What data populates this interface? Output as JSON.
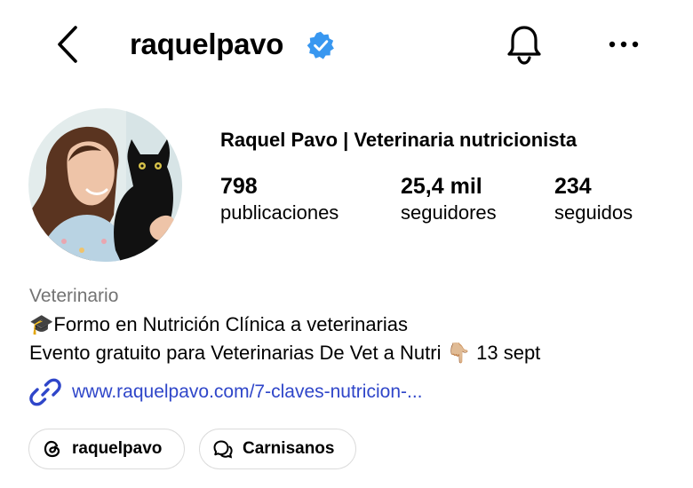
{
  "header": {
    "username": "raquelpavo",
    "icons": {
      "back": "chevron-left-icon",
      "verified": "verified-badge-icon",
      "notifications": "bell-icon",
      "more": "more-horizontal-icon"
    }
  },
  "profile": {
    "full_name": "Raquel Pavo | Veterinaria nutricionista",
    "stats": [
      {
        "value": "798",
        "label": "publicaciones"
      },
      {
        "value": "25,4 mil",
        "label": "seguidores"
      },
      {
        "value": "234",
        "label": "seguidos"
      }
    ],
    "category": "Veterinario",
    "bio": {
      "line1_emoji": "🎓",
      "line1_text": "Formo en Nutrición Clínica a veterinarias",
      "line2_text_before": "Evento gratuito para Veterinarias De Vet a Nutri ",
      "line2_emoji": "👇🏼",
      "line2_text_after": " 13 sept"
    },
    "link": {
      "icon": "link-icon",
      "text": "www.raquelpavo.com/7-claves-nutricion-..."
    }
  },
  "chips": [
    {
      "label": "raquelpavo",
      "icon": "threads-icon"
    },
    {
      "label": "Carnisanos",
      "icon": "channel-chat-icon"
    }
  ],
  "colors": {
    "verified": "#3897f0",
    "link": "#2f46c9",
    "category": "#737373",
    "chip_border": "#dbdbdb"
  }
}
